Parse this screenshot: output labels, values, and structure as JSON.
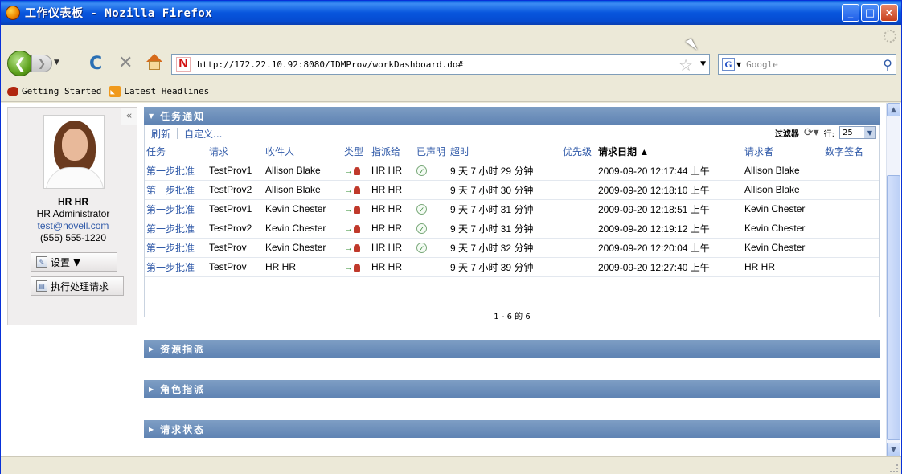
{
  "window": {
    "title": "工作仪表板 - Mozilla Firefox",
    "min_glyph": "_",
    "max_glyph": "□",
    "close_glyph": "×"
  },
  "nav": {
    "url": "http://172.22.10.92:8080/IDMProv/workDashboard.do#",
    "search_placeholder": "Google",
    "site_icon_letter": "N",
    "search_engine_letter": "G"
  },
  "bookmarks": [
    {
      "label": "Getting Started"
    },
    {
      "label": "Latest Headlines"
    }
  ],
  "user": {
    "name": "HR HR",
    "role": "HR Administrator",
    "email": "test@novell.com",
    "phone": "(555) 555-1220",
    "settings_label": "设置",
    "process_label": "执行处理请求"
  },
  "tasks_panel": {
    "title": "任务通知",
    "refresh_label": "刷新",
    "customize_label": "自定义...",
    "filter_label": "过滤器",
    "rows_label": "行:",
    "rows_value": "25",
    "pager_text": "1 - 6 的 6",
    "columns": [
      "任务",
      "请求",
      "收件人",
      "类型",
      "指派给",
      "已声明",
      "超时",
      "优先级",
      "请求日期 ▲",
      "请求者",
      "数字签名"
    ],
    "rows": [
      {
        "task": "第一步批准",
        "request": "TestProv1",
        "recipient": "Allison Blake",
        "assignee": "HR HR",
        "claimed": true,
        "timeout": "9 天 7 小时 29 分钟",
        "priority": "",
        "date": "2009-09-20 12:17:44 上午",
        "requester": "Allison Blake",
        "signature": ""
      },
      {
        "task": "第一步批准",
        "request": "TestProv2",
        "recipient": "Allison Blake",
        "assignee": "HR HR",
        "claimed": false,
        "timeout": "9 天 7 小时 30 分钟",
        "priority": "",
        "date": "2009-09-20 12:18:10 上午",
        "requester": "Allison Blake",
        "signature": ""
      },
      {
        "task": "第一步批准",
        "request": "TestProv1",
        "recipient": "Kevin Chester",
        "assignee": "HR HR",
        "claimed": true,
        "timeout": "9 天 7 小时 31 分钟",
        "priority": "",
        "date": "2009-09-20 12:18:51 上午",
        "requester": "Kevin Chester",
        "signature": ""
      },
      {
        "task": "第一步批准",
        "request": "TestProv2",
        "recipient": "Kevin Chester",
        "assignee": "HR HR",
        "claimed": true,
        "timeout": "9 天 7 小时 31 分钟",
        "priority": "",
        "date": "2009-09-20 12:19:12 上午",
        "requester": "Kevin Chester",
        "signature": ""
      },
      {
        "task": "第一步批准",
        "request": "TestProv",
        "recipient": "Kevin Chester",
        "assignee": "HR HR",
        "claimed": true,
        "timeout": "9 天 7 小时 32 分钟",
        "priority": "",
        "date": "2009-09-20 12:20:04 上午",
        "requester": "Kevin Chester",
        "signature": ""
      },
      {
        "task": "第一步批准",
        "request": "TestProv",
        "recipient": "HR HR",
        "assignee": "HR HR",
        "claimed": false,
        "timeout": "9 天 7 小时 39 分钟",
        "priority": "",
        "date": "2009-09-20 12:27:40 上午",
        "requester": "HR HR",
        "signature": ""
      }
    ]
  },
  "other_panels": {
    "resources": "资源指派",
    "roles": "角色指派",
    "request_status": "请求状态"
  },
  "icons": [
    "firefox-logo",
    "back-arrow-icon",
    "forward-arrow-icon",
    "reload-icon",
    "stop-icon",
    "home-icon",
    "bookmark-star-icon",
    "search-icon",
    "collapse-icon",
    "settings-icon",
    "process-icon",
    "refresh-icon",
    "check-icon",
    "assign-type-icon"
  ]
}
